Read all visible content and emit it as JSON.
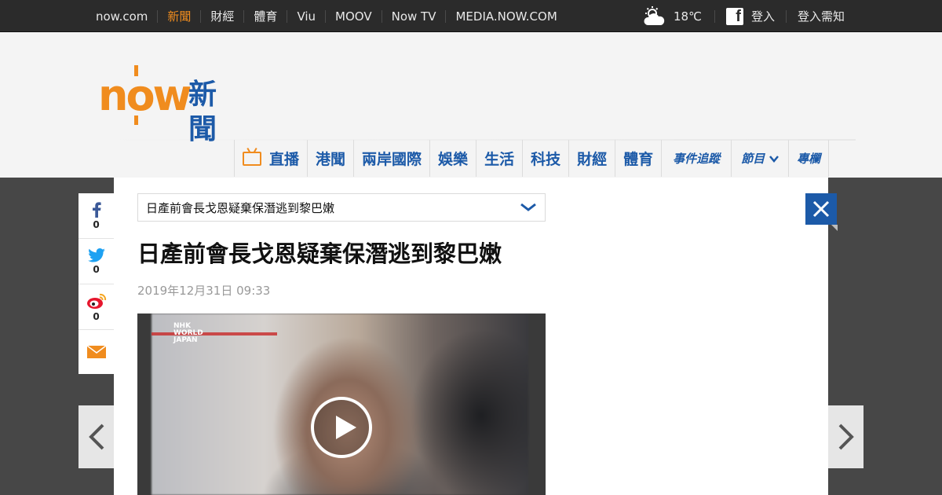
{
  "topbar": {
    "links": [
      {
        "label": "now.com",
        "active": false
      },
      {
        "label": "新聞",
        "active": true
      },
      {
        "label": "財經",
        "active": false
      },
      {
        "label": "體育",
        "active": false
      },
      {
        "label": "Viu",
        "active": false
      },
      {
        "label": "MOOV",
        "active": false
      },
      {
        "label": "Now TV",
        "active": false
      },
      {
        "label": "MEDIA.NOW.COM",
        "active": false
      }
    ],
    "temperature": "18℃",
    "weather_icon": "sun-cloud-icon",
    "login": "登入",
    "login_info": "登入需知"
  },
  "logo": {
    "brand": "now",
    "section": "新聞"
  },
  "nav": {
    "items": [
      "直播",
      "港聞",
      "兩岸國際",
      "娛樂",
      "生活",
      "科技",
      "財經",
      "體育",
      "事件追蹤",
      "節目",
      "專欄"
    ]
  },
  "share": {
    "facebook_count": "0",
    "twitter_count": "0",
    "weibo_count": "0"
  },
  "article": {
    "dropdown_title": "日產前會長戈恩疑棄保潛逃到黎巴嫩",
    "title": "日產前會長戈恩疑棄保潛逃到黎巴嫩",
    "date": "2019年12月31日 09:33",
    "video_watermark": "NHK WORLD JAPAN"
  },
  "colors": {
    "brand_orange": "#f08c1e",
    "brand_blue": "#1c5aa8",
    "topbar_bg": "#2b2b2b"
  }
}
